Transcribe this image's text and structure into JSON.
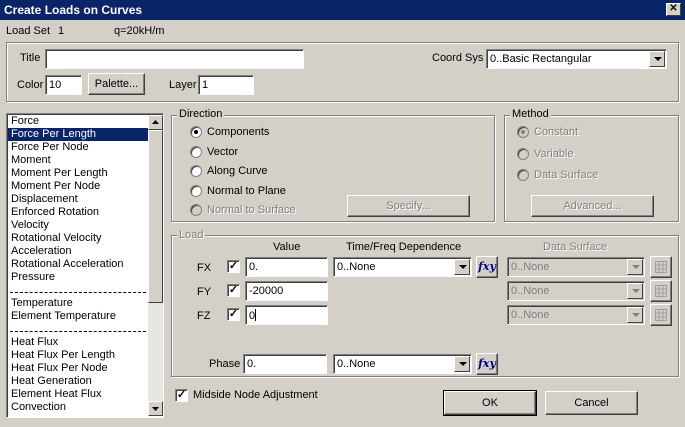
{
  "window": {
    "title": "Create Loads on Curves",
    "close_glyph": "✕"
  },
  "header": {
    "load_set_label": "Load Set",
    "load_set_value": "1",
    "load_set_desc": "q=20kH/m"
  },
  "props": {
    "title_label": "Title",
    "title_value": "",
    "color_label": "Color",
    "color_value": "10",
    "palette_label": "Palette...",
    "layer_label": "Layer",
    "layer_value": "1",
    "coord_sys_label": "Coord Sys",
    "coord_sys_value": "0..Basic Rectangular"
  },
  "load_types": {
    "group1": [
      "Force",
      "Force Per Length",
      "Force Per Node",
      "Moment",
      "Moment Per Length",
      "Moment Per Node",
      "Displacement",
      "Enforced Rotation",
      "Velocity",
      "Rotational Velocity",
      "Acceleration",
      "Rotational Acceleration",
      "Pressure"
    ],
    "group2": [
      "Temperature",
      "Element Temperature"
    ],
    "group3": [
      "Heat Flux",
      "Heat Flux Per Length",
      "Heat Flux Per Node",
      "Heat Generation",
      "Element Heat Flux",
      "Convection"
    ],
    "selected": "Force Per Length"
  },
  "direction": {
    "label": "Direction",
    "options": [
      "Components",
      "Vector",
      "Along Curve",
      "Normal to Plane",
      "Normal to Surface"
    ],
    "selected": "Components",
    "specify_label": "Specify..."
  },
  "method": {
    "label": "Method",
    "options": [
      "Constant",
      "Variable",
      "Data Surface"
    ],
    "selected": "Constant",
    "advanced_label": "Advanced..."
  },
  "load": {
    "label": "Load",
    "col_value": "Value",
    "col_time": "Time/Freq Dependence",
    "col_surface": "Data Surface",
    "rows": [
      {
        "name": "FX",
        "checked": true,
        "value": "0.",
        "time": "0..None",
        "surface": "0..None"
      },
      {
        "name": "FY",
        "checked": true,
        "value": "-20000",
        "surface": "0..None"
      },
      {
        "name": "FZ",
        "checked": true,
        "value": "0",
        "surface": "0..None"
      }
    ],
    "phase_label": "Phase",
    "phase_value": "0.",
    "phase_time": "0..None",
    "fxy_label": "fxy"
  },
  "midside": {
    "label": "Midside Node Adjustment",
    "checked": true
  },
  "buttons": {
    "ok": "OK",
    "cancel": "Cancel"
  }
}
